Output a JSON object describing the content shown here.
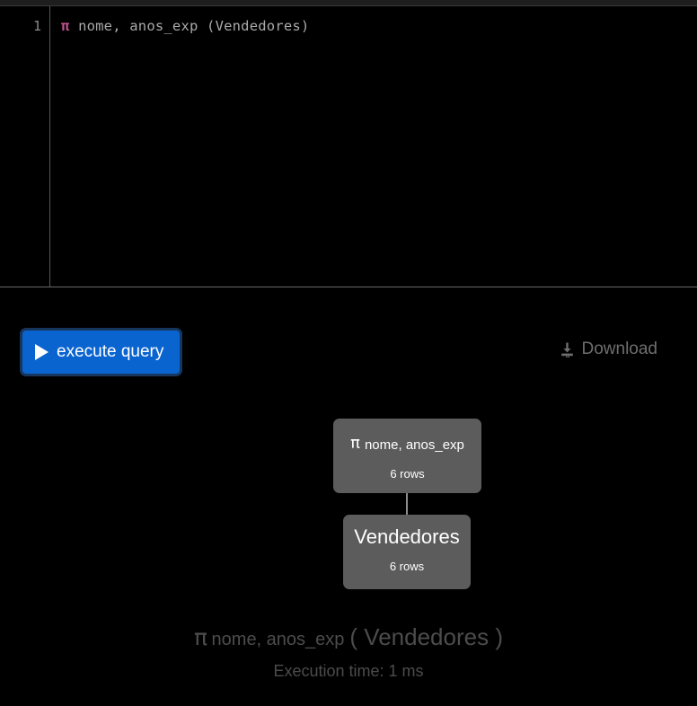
{
  "editor": {
    "line_number": "1",
    "code_operator": "π",
    "code_rest": " nome, anos_exp (Vendedores)"
  },
  "toolbar": {
    "execute_label": "execute query",
    "execute_icon": "play-icon",
    "execute_color": "#0a64d0",
    "download_label": "Download",
    "download_icon": "download-icon"
  },
  "graph": {
    "projection_node": {
      "operator": "π",
      "attributes": "nome, anos_exp",
      "rows": "6 rows"
    },
    "relation_node": {
      "name": "Vendedores",
      "rows": "6 rows"
    },
    "node_color": "#5c5c5c",
    "connector_color": "#8c8c8c"
  },
  "caption": {
    "operator": "π",
    "attributes": "nome, anos_exp",
    "relation": "( Vendedores )",
    "execution_time": "Execution time: 1 ms"
  }
}
